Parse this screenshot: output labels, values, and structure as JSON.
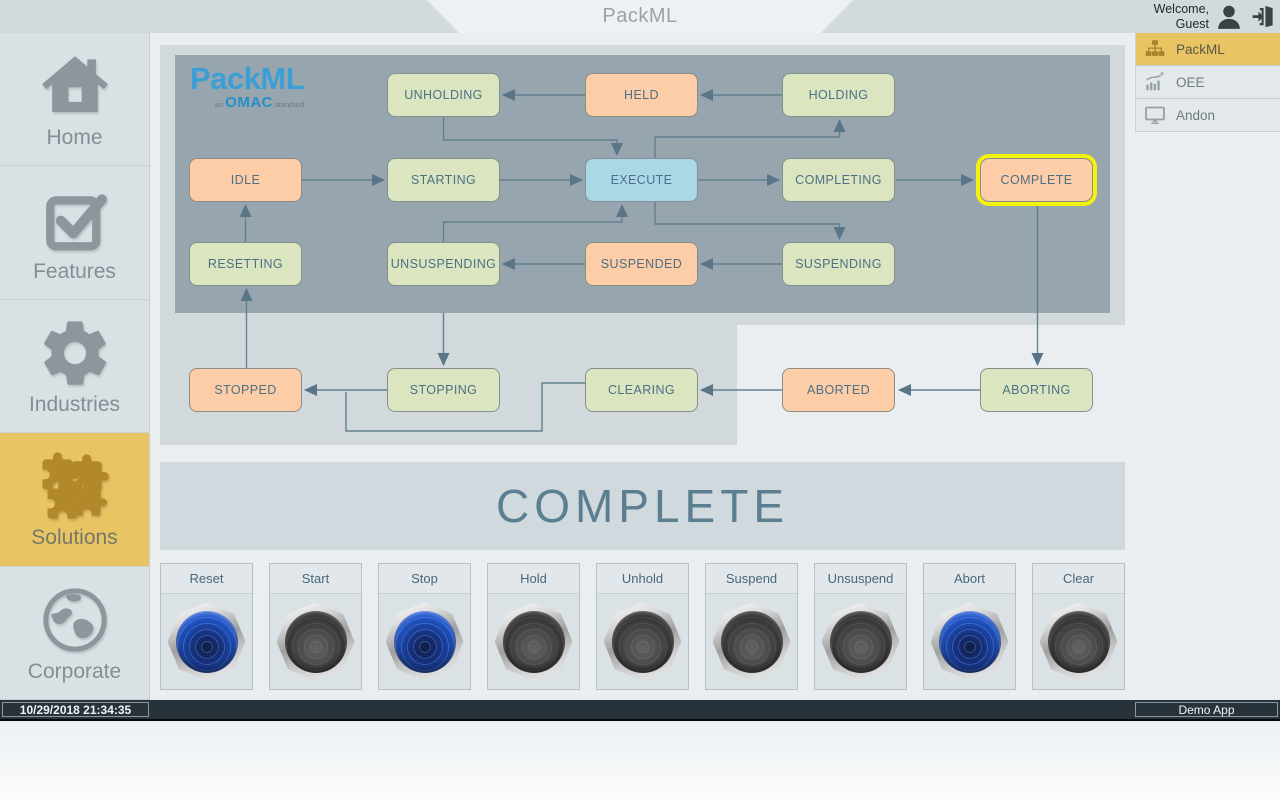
{
  "header": {
    "title": "PackML",
    "welcome_line1": "Welcome,",
    "welcome_line2": "Guest"
  },
  "left_sidebar": {
    "items": [
      {
        "label": "Home",
        "icon": "home-icon",
        "selected": false
      },
      {
        "label": "Features",
        "icon": "checkbox-icon",
        "selected": false
      },
      {
        "label": "Industries",
        "icon": "gear-icon",
        "selected": false
      },
      {
        "label": "Solutions",
        "icon": "puzzle-icon",
        "selected": true
      },
      {
        "label": "Corporate",
        "icon": "globe-icon",
        "selected": false
      }
    ]
  },
  "right_sidebar": {
    "items": [
      {
        "label": "PackML",
        "icon": "sitemap-icon",
        "selected": true
      },
      {
        "label": "OEE",
        "icon": "trend-chart-icon",
        "selected": false
      },
      {
        "label": "Andon",
        "icon": "monitor-icon",
        "selected": false
      }
    ]
  },
  "diagram": {
    "logo": {
      "brand": "PackML",
      "sub_prefix": "an",
      "sub_brand": "OMAC",
      "sub_suffix": "standard"
    },
    "current_state": "COMPLETE",
    "states": [
      {
        "label": "UNHOLDING",
        "kind": "acting",
        "col": 2,
        "row": 1,
        "highlighted": false
      },
      {
        "label": "HELD",
        "kind": "wait",
        "col": 3,
        "row": 1,
        "highlighted": false
      },
      {
        "label": "HOLDING",
        "kind": "acting",
        "col": 4,
        "row": 1,
        "highlighted": false
      },
      {
        "label": "IDLE",
        "kind": "wait",
        "col": 1,
        "row": 2,
        "highlighted": false
      },
      {
        "label": "STARTING",
        "kind": "acting",
        "col": 2,
        "row": 2,
        "highlighted": false
      },
      {
        "label": "EXECUTE",
        "kind": "execute",
        "col": 3,
        "row": 2,
        "highlighted": false
      },
      {
        "label": "COMPLETING",
        "kind": "acting",
        "col": 4,
        "row": 2,
        "highlighted": false
      },
      {
        "label": "COMPLETE",
        "kind": "wait",
        "col": 5,
        "row": 2,
        "highlighted": true
      },
      {
        "label": "RESETTING",
        "kind": "acting",
        "col": 1,
        "row": 3,
        "highlighted": false
      },
      {
        "label": "UNSUSPENDING",
        "kind": "acting",
        "col": 2,
        "row": 3,
        "highlighted": false
      },
      {
        "label": "SUSPENDED",
        "kind": "wait",
        "col": 3,
        "row": 3,
        "highlighted": false
      },
      {
        "label": "SUSPENDING",
        "kind": "acting",
        "col": 4,
        "row": 3,
        "highlighted": false
      },
      {
        "label": "STOPPED",
        "kind": "wait",
        "col": 1,
        "row": 4,
        "highlighted": false
      },
      {
        "label": "STOPPING",
        "kind": "acting",
        "col": 2,
        "row": 4,
        "highlighted": false
      },
      {
        "label": "CLEARING",
        "kind": "acting",
        "col": 3,
        "row": 4,
        "highlighted": false
      },
      {
        "label": "ABORTED",
        "kind": "wait",
        "col": 4,
        "row": 4,
        "highlighted": false
      },
      {
        "label": "ABORTING",
        "kind": "acting",
        "col": 5,
        "row": 4,
        "highlighted": false
      }
    ]
  },
  "status_banner": {
    "text": "COMPLETE"
  },
  "controls": {
    "buttons": [
      {
        "label": "Reset",
        "active": true
      },
      {
        "label": "Start",
        "active": false
      },
      {
        "label": "Stop",
        "active": true
      },
      {
        "label": "Hold",
        "active": false
      },
      {
        "label": "Unhold",
        "active": false
      },
      {
        "label": "Suspend",
        "active": false
      },
      {
        "label": "Unsuspend",
        "active": false
      },
      {
        "label": "Abort",
        "active": true
      },
      {
        "label": "Clear",
        "active": false
      }
    ]
  },
  "footer": {
    "timestamp": "10/29/2018 21:34:35",
    "app_name": "Demo App"
  },
  "colors": {
    "accent_gold": "#e8c463",
    "state_wait": "#fccda6",
    "state_acting": "#dbe6c0",
    "state_execute": "#abd8e7",
    "state_highlight": "#f2f211",
    "button_active": "#2356c8",
    "button_inactive": "#333333",
    "footer_bar": "#27323a"
  }
}
